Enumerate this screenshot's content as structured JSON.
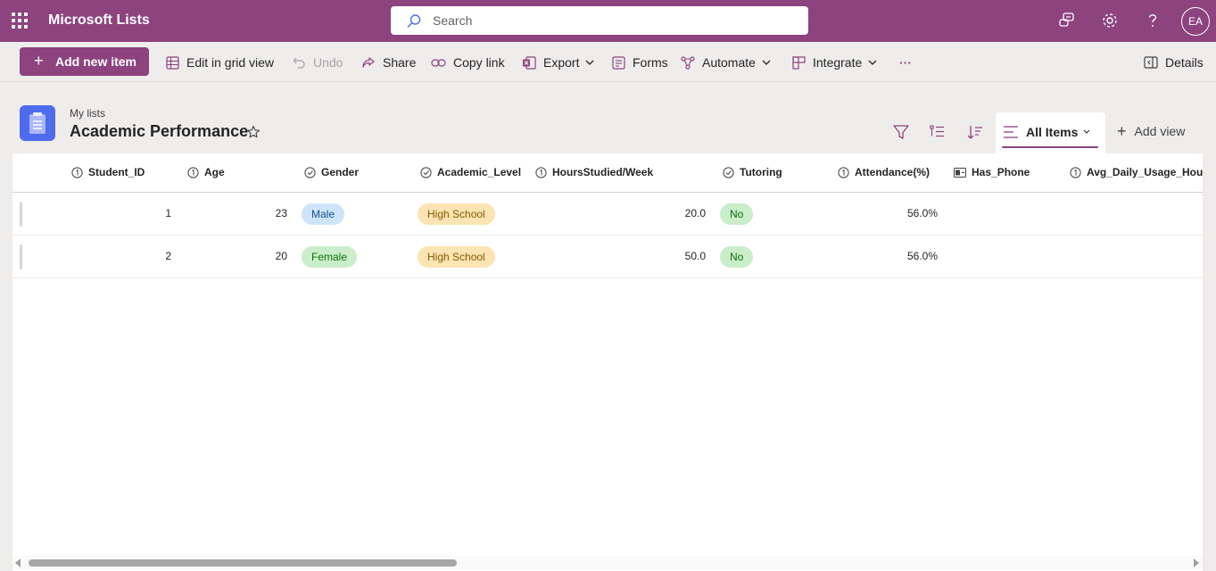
{
  "app": {
    "title": "Microsoft Lists"
  },
  "search": {
    "placeholder": "Search"
  },
  "user": {
    "initials": "EA"
  },
  "toolbar": {
    "add_label": "Add new item",
    "edit_grid_label": "Edit in grid view",
    "undo_label": "Undo",
    "share_label": "Share",
    "copy_link_label": "Copy link",
    "export_label": "Export",
    "forms_label": "Forms",
    "automate_label": "Automate",
    "integrate_label": "Integrate",
    "more_label": "···",
    "details_label": "Details"
  },
  "list": {
    "breadcrumb": "My lists",
    "title": "Academic Performance"
  },
  "views": {
    "current": "All Items",
    "add_label": "Add view"
  },
  "columns": [
    {
      "label": "Student_ID",
      "type_icon": "number-icon"
    },
    {
      "label": "Age",
      "type_icon": "number-icon"
    },
    {
      "label": "Gender",
      "type_icon": "choice-icon"
    },
    {
      "label": "Academic_Level",
      "type_icon": "choice-icon"
    },
    {
      "label": "HoursStudied/Week",
      "type_icon": "number-icon"
    },
    {
      "label": "Tutoring",
      "type_icon": "choice-icon"
    },
    {
      "label": "Attendance(%)",
      "type_icon": "number-icon"
    },
    {
      "label": "Has_Phone",
      "type_icon": "yes-no-icon"
    },
    {
      "label": "Avg_Daily_Usage_Hours",
      "type_icon": "number-icon"
    }
  ],
  "rows": [
    {
      "student_id": "1",
      "age": "23",
      "gender": "Male",
      "academic_level": "High School",
      "hours_studied": "20.0",
      "tutoring": "No",
      "attendance": "56.0%"
    },
    {
      "student_id": "2",
      "age": "20",
      "gender": "Female",
      "academic_level": "High School",
      "hours_studied": "50.0",
      "tutoring": "No",
      "attendance": "56.0%"
    }
  ],
  "colors": {
    "brand": "#8c437e",
    "list_icon": "#4f6bed",
    "pill_blue": "#cfe4fa",
    "pill_green": "#c9eec9",
    "pill_amber": "#fce4b3"
  }
}
